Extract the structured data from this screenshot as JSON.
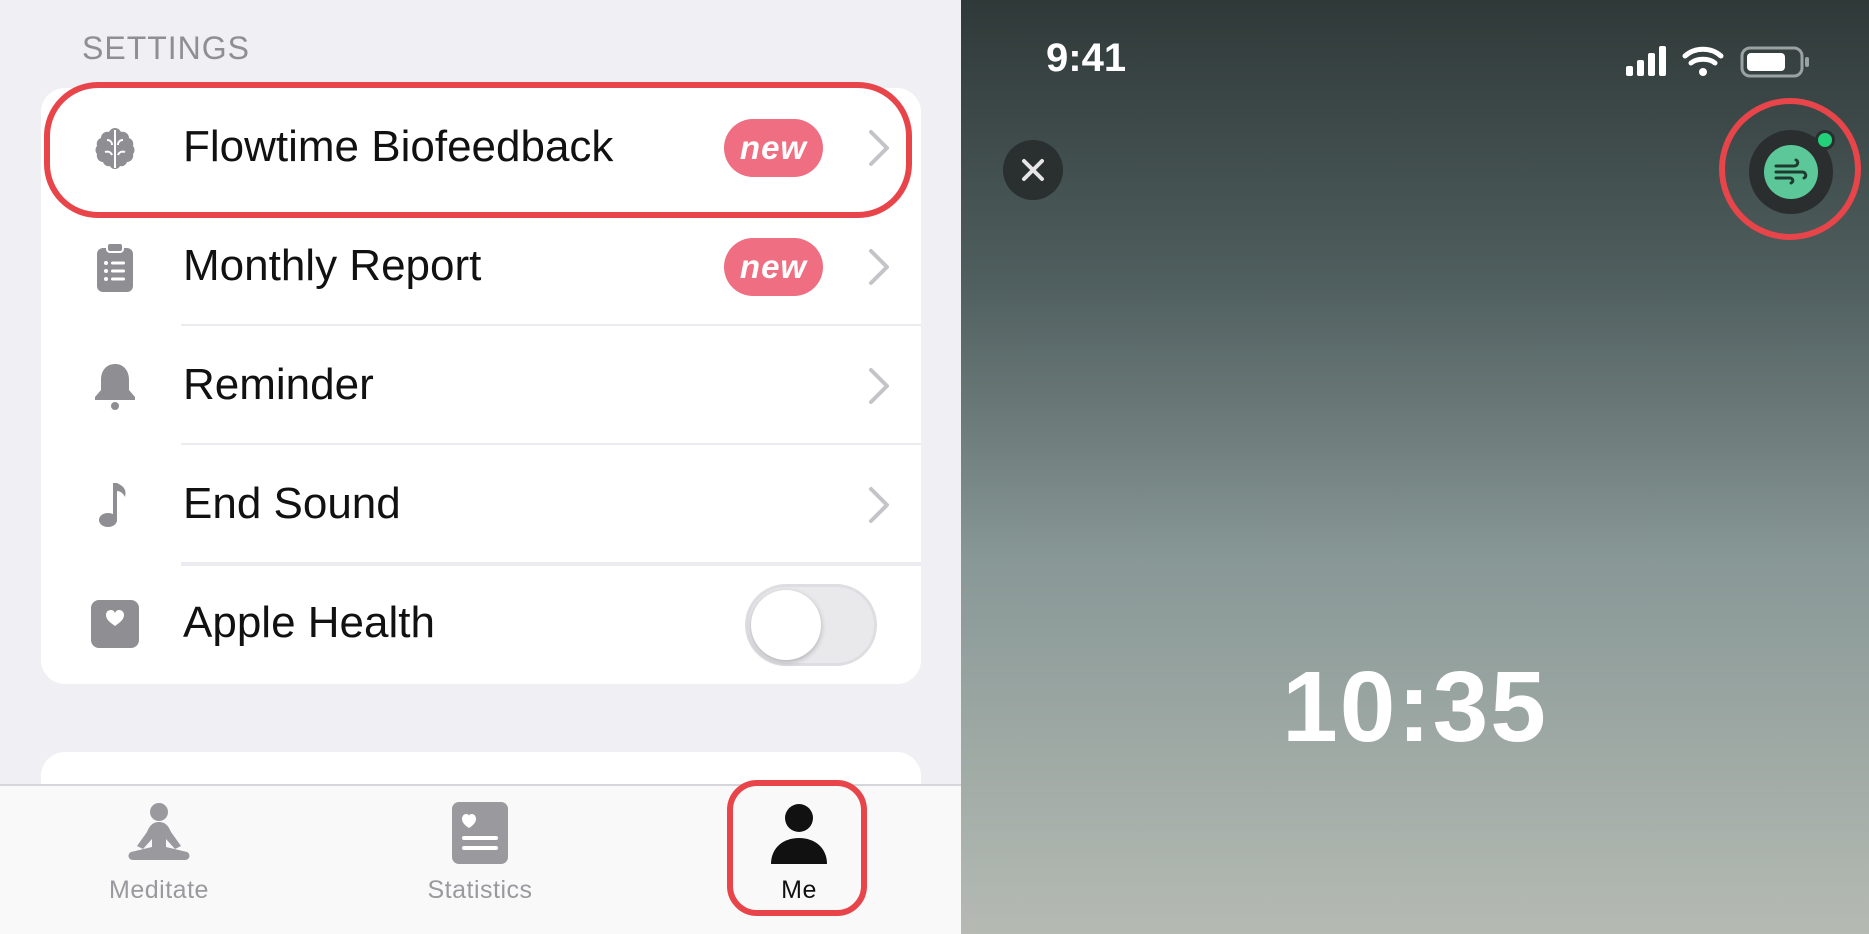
{
  "settings": {
    "section_title": "SETTINGS",
    "rows": [
      {
        "label": "Flowtime Biofeedback",
        "badge": "new",
        "icon": "brain-icon"
      },
      {
        "label": "Monthly Report",
        "badge": "new",
        "icon": "clipboard-icon"
      },
      {
        "label": "Reminder",
        "icon": "bell-icon"
      },
      {
        "label": "End Sound",
        "icon": "music-note-icon"
      },
      {
        "label": "Apple Health",
        "icon": "health-heart-icon",
        "toggle": false
      }
    ]
  },
  "tabbar": {
    "tabs": [
      {
        "label": "Meditate",
        "icon": "meditate-icon",
        "active": false
      },
      {
        "label": "Statistics",
        "icon": "statistics-icon",
        "active": false
      },
      {
        "label": "Me",
        "icon": "person-icon",
        "active": true
      }
    ]
  },
  "timer_screen": {
    "status_time": "9:41",
    "timer": "10:35",
    "device_connected": true
  },
  "colors": {
    "highlight": "#e8454a",
    "badge": "#ef6e82",
    "device": "#5cc89a"
  }
}
